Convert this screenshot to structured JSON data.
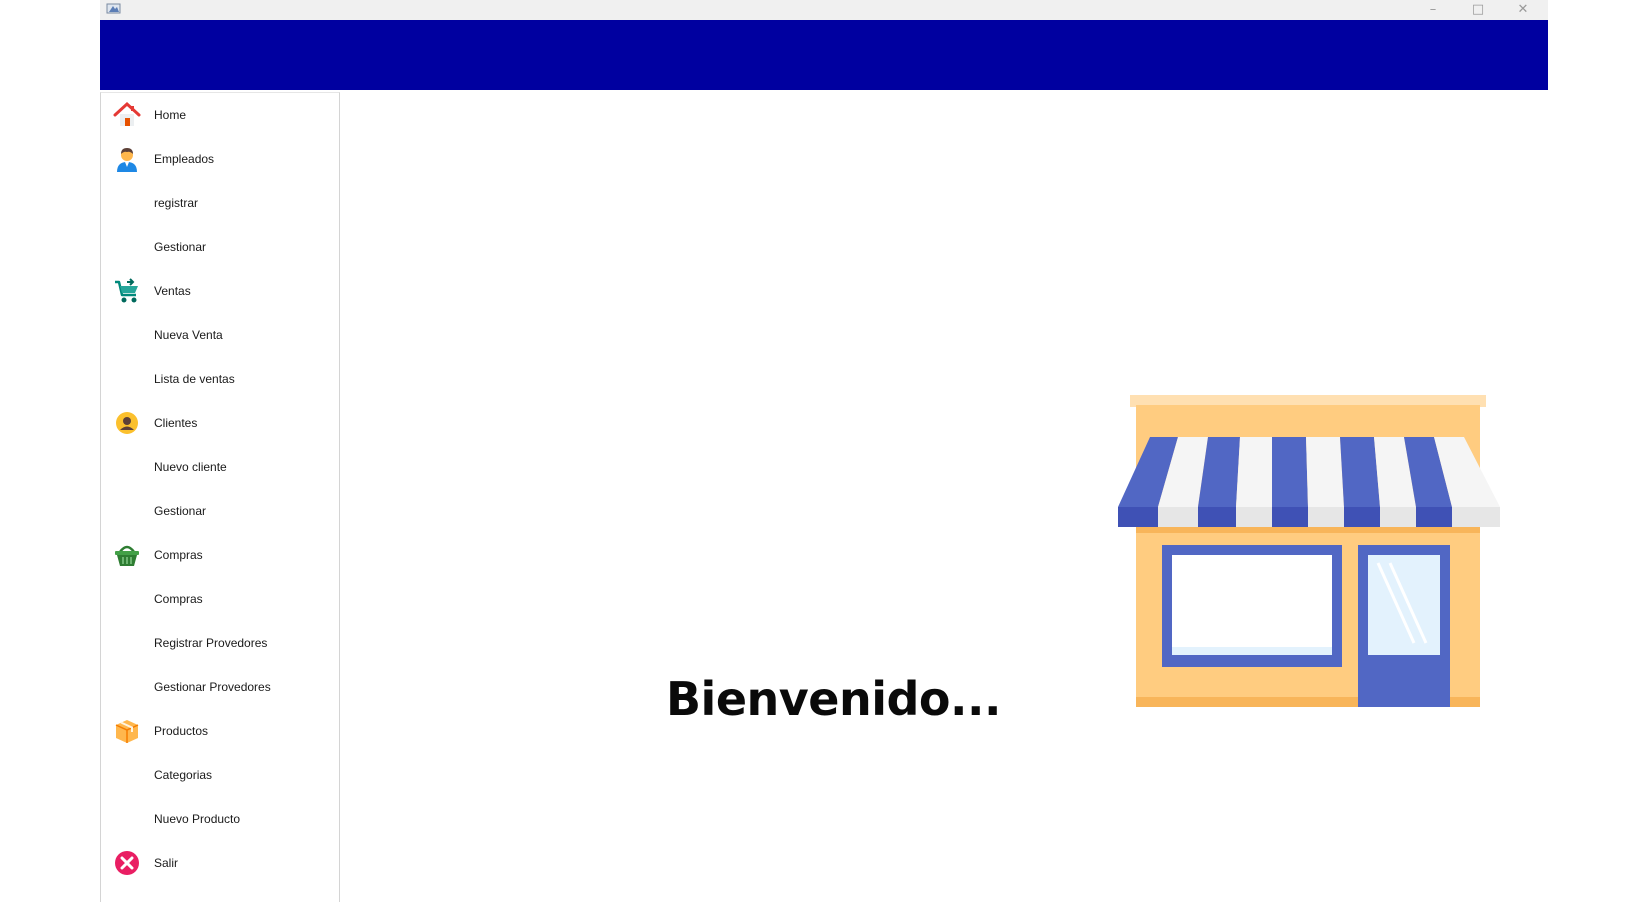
{
  "window": {
    "controls": {
      "minimize": "–",
      "maximize": "□",
      "close": "✕"
    }
  },
  "colors": {
    "header": "#0000a0",
    "sidebar_border": "#d4d4d4"
  },
  "sidebar": {
    "items": [
      {
        "label": "Home",
        "icon": "home-icon"
      },
      {
        "label": "Empleados",
        "icon": "employee-icon"
      },
      {
        "label": "registrar"
      },
      {
        "label": "Gestionar"
      },
      {
        "label": "Ventas",
        "icon": "cart-icon"
      },
      {
        "label": "Nueva Venta"
      },
      {
        "label": "Lista de ventas"
      },
      {
        "label": "Clientes",
        "icon": "client-icon"
      },
      {
        "label": "Nuevo cliente"
      },
      {
        "label": "Gestionar"
      },
      {
        "label": "Compras",
        "icon": "basket-icon"
      },
      {
        "label": "Compras"
      },
      {
        "label": "Registrar Provedores"
      },
      {
        "label": "Gestionar Provedores"
      },
      {
        "label": "Productos",
        "icon": "box-icon"
      },
      {
        "label": "Categorias"
      },
      {
        "label": "Nuevo Producto"
      },
      {
        "label": "Salir",
        "icon": "exit-icon"
      }
    ]
  },
  "main": {
    "welcome_text": "Bienvenido...",
    "illustration": "storefront-illustration"
  }
}
